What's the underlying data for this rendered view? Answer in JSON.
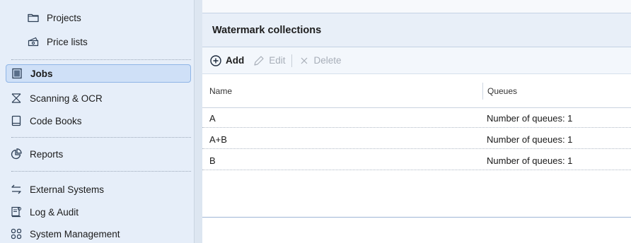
{
  "sidebar": {
    "items": [
      {
        "label": "Projects",
        "icon": "folder-icon"
      },
      {
        "label": "Price lists",
        "icon": "price-list-icon"
      },
      {
        "label": "Jobs",
        "icon": "jobs-icon",
        "active": true
      },
      {
        "label": "Scanning & OCR",
        "icon": "scanner-icon"
      },
      {
        "label": "Code Books",
        "icon": "code-book-icon"
      },
      {
        "label": "Reports",
        "icon": "pie-chart-icon"
      },
      {
        "label": "External Systems",
        "icon": "sync-arrows-icon"
      },
      {
        "label": "Log & Audit",
        "icon": "log-icon"
      },
      {
        "label": "System Management",
        "icon": "grid-icon"
      }
    ]
  },
  "panel": {
    "title": "Watermark collections"
  },
  "toolbar": {
    "add_label": "Add",
    "edit_label": "Edit",
    "delete_label": "Delete"
  },
  "table": {
    "columns": [
      "Name",
      "Queues"
    ],
    "rows": [
      {
        "name": "A",
        "queues": "Number of queues: 1"
      },
      {
        "name": "A+B",
        "queues": "Number of queues: 1"
      },
      {
        "name": "B",
        "queues": "Number of queues: 1"
      }
    ]
  },
  "colors": {
    "sidebar_bg": "#e6eef9",
    "active_item_bg": "#cfe0f7",
    "active_item_border": "#8fb5e6",
    "accent": "#1f5fb4",
    "disabled_text": "#a7aeb8"
  }
}
